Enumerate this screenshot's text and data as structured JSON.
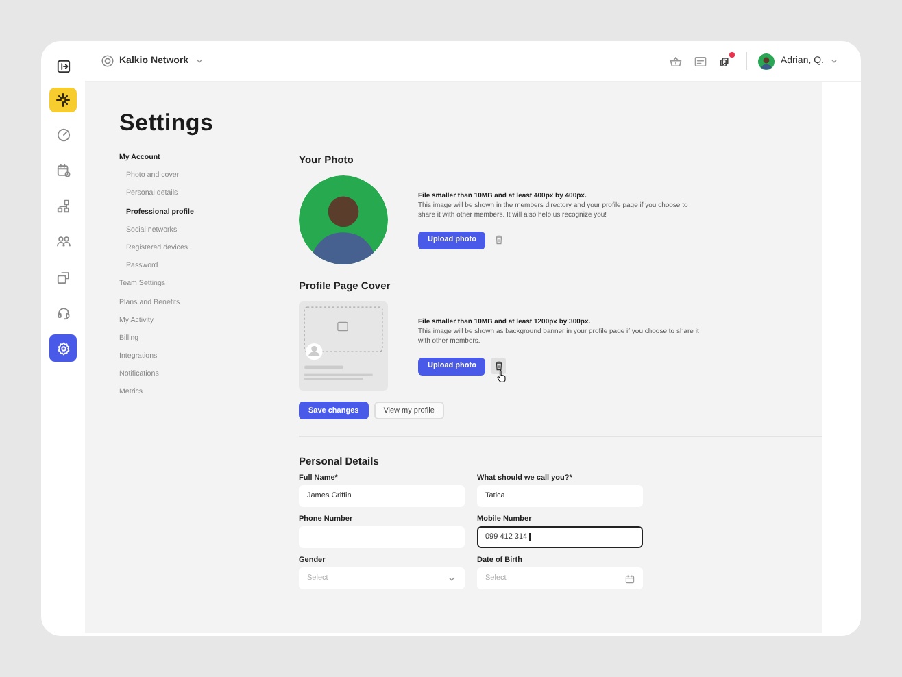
{
  "topbar": {
    "workspace": "Kalkio Network",
    "has_notification": true,
    "user": "Adrian, Q."
  },
  "rail": [
    {
      "selected": false
    },
    {
      "selected": false
    },
    {
      "selected": false
    },
    {
      "selected": false
    },
    {
      "selected": false
    },
    {
      "selected": false
    },
    {
      "selected": true
    }
  ],
  "page_title": "Settings",
  "settings_nav": [
    {
      "label": "My Account",
      "children": [
        {
          "label": "Photo and cover",
          "selected": false
        },
        {
          "label": "Personal details",
          "selected": false
        },
        {
          "label": "Professional profile",
          "selected": true
        },
        {
          "label": "Social networks",
          "selected": false
        },
        {
          "label": "Registered devices",
          "selected": false
        },
        {
          "label": "Password",
          "selected": false
        }
      ]
    },
    {
      "label": "Team Settings",
      "selected": false
    },
    {
      "label": "Plans and Benefits",
      "selected": false
    },
    {
      "label": "My Activity",
      "selected": false
    },
    {
      "label": "Billing",
      "selected": false
    },
    {
      "label": "Integrations",
      "selected": false
    },
    {
      "label": "Notifications",
      "selected": false
    },
    {
      "label": "Metrics",
      "selected": false
    }
  ],
  "photo_sections": [
    {
      "kind": "avatar",
      "heading": "Your Photo",
      "requirement": "File smaller than 10MB and at least 400px by 400px.",
      "description": "This image will be shown in the members directory and your profile page if you choose to share it with other members. It will also help us recognize you!",
      "upload_button": "Upload photo",
      "delete_hovered": false
    },
    {
      "kind": "cover",
      "heading": "Profile Page Cover",
      "requirement": "File smaller than 10MB and at least 1200px by 300px.",
      "description": "This image will be shown as background banner in your profile page if you choose to share it with other members.",
      "upload_button": "Upload photo",
      "delete_hovered": true
    }
  ],
  "actions": [
    {
      "label": "Save changes",
      "kind": "primary"
    },
    {
      "label": "View my profile",
      "kind": "secondary"
    }
  ],
  "personal_details": {
    "heading": "Personal Details",
    "fields": [
      {
        "label": "Full Name*",
        "kind": "text",
        "value": "James Griffin",
        "focused": false
      },
      {
        "label": "What should we call you?*",
        "kind": "text",
        "value": "Tatica",
        "focused": false
      },
      {
        "label": "Phone Number",
        "kind": "text",
        "focused": false
      },
      {
        "label": "Mobile Number",
        "kind": "text",
        "value": "099 412 314",
        "focused": true
      },
      {
        "label": "Gender",
        "kind": "select",
        "placeholder": "Select",
        "focused": false
      },
      {
        "label": "Date of Birth",
        "kind": "date",
        "placeholder": "Select",
        "focused": false
      }
    ]
  }
}
